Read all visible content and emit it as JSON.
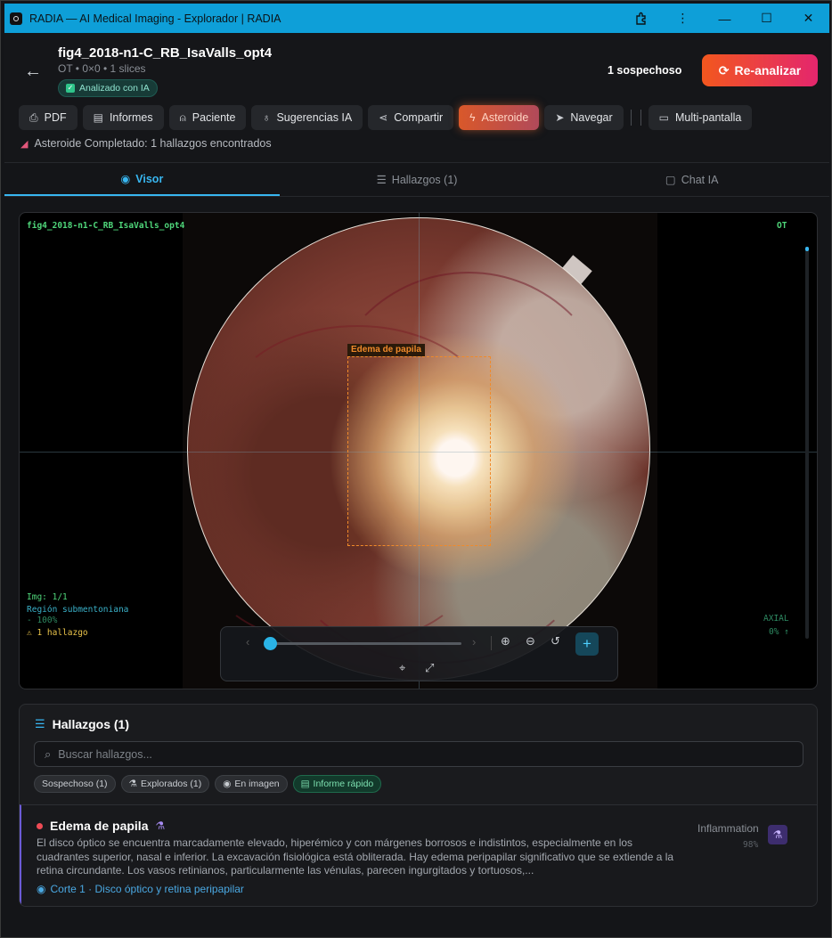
{
  "window": {
    "title": "RADIA — AI Medical Imaging - Explorador | RADIA",
    "controls": [
      "extensions",
      "more",
      "minimize",
      "maximize",
      "close"
    ]
  },
  "header": {
    "back_icon": "arrow-left-icon",
    "title": "fig4_2018-n1-C_RB_IsaValls_opt4",
    "meta": "OT • 0×0 • 1 slices",
    "ai_badge": "Analizado con IA",
    "suspect_count": "1 sospechoso",
    "reanalyze_label": "Re-analizar",
    "accent_gradient": [
      "#f2571e",
      "#e4266d"
    ]
  },
  "toolbar": {
    "buttons": [
      {
        "label": "PDF",
        "icon": "file-download-icon"
      },
      {
        "label": "Informes",
        "icon": "document-icon"
      },
      {
        "label": "Paciente",
        "icon": "user-icon"
      },
      {
        "label": "Sugerencias IA",
        "icon": "lightbulb-icon"
      },
      {
        "label": "Compartir",
        "icon": "share-icon"
      },
      {
        "label": "Asteroide",
        "icon": "zap-icon",
        "active": true
      },
      {
        "label": "Navegar",
        "icon": "navigation-icon"
      },
      {
        "label": "Multi-pantalla",
        "icon": "monitor-icon"
      }
    ],
    "status": "Asteroide Completado: 1 hallazgos encontrados"
  },
  "tabs": [
    {
      "label": "Visor",
      "icon": "eye-icon",
      "active": true
    },
    {
      "label": "Hallazgos (1)",
      "icon": "list-icon"
    },
    {
      "label": "Chat IA",
      "icon": "chat-icon"
    }
  ],
  "viewer": {
    "filename": "fig4_2018-n1-C_RB_IsaValls_opt4",
    "modality": "OT",
    "roi_label": "Edema de papila",
    "img_index": "Img: 1/1",
    "region": "Región submentoniana",
    "zoom": "- 100%",
    "findings_count": "⚠ 1 hallazgo",
    "plane": "AXIAL",
    "progress": "0% ↑",
    "slider_value": 0
  },
  "findings": {
    "title": "Hallazgos (1)",
    "search_placeholder": "Buscar hallazgos...",
    "chips": [
      {
        "label": "Sospechoso (1)"
      },
      {
        "label": "Explorados (1)",
        "icon": "flask-icon"
      },
      {
        "label": "En imagen",
        "icon": "eye-icon"
      },
      {
        "label": "Informe rápido",
        "icon": "document-icon",
        "highlight": true
      }
    ],
    "items": [
      {
        "title": "Edema de papila",
        "severity_color": "#ee4b55",
        "description": "El disco óptico se encuentra marcadamente elevado, hiperémico y con márgenes borrosos e indistintos, especialmente en los cuadrantes superior, nasal e inferior. La excavación fisiológica está obliterada. Hay edema peripapilar significativo que se extiende a la retina circundante. Los vasos retinianos, particularmente las vénulas, parecen ingurgitados y tortuosos,...",
        "link": "Corte 1 · Disco óptico y retina peripapilar",
        "category": "Inflammation",
        "confidence": "98%"
      }
    ]
  }
}
